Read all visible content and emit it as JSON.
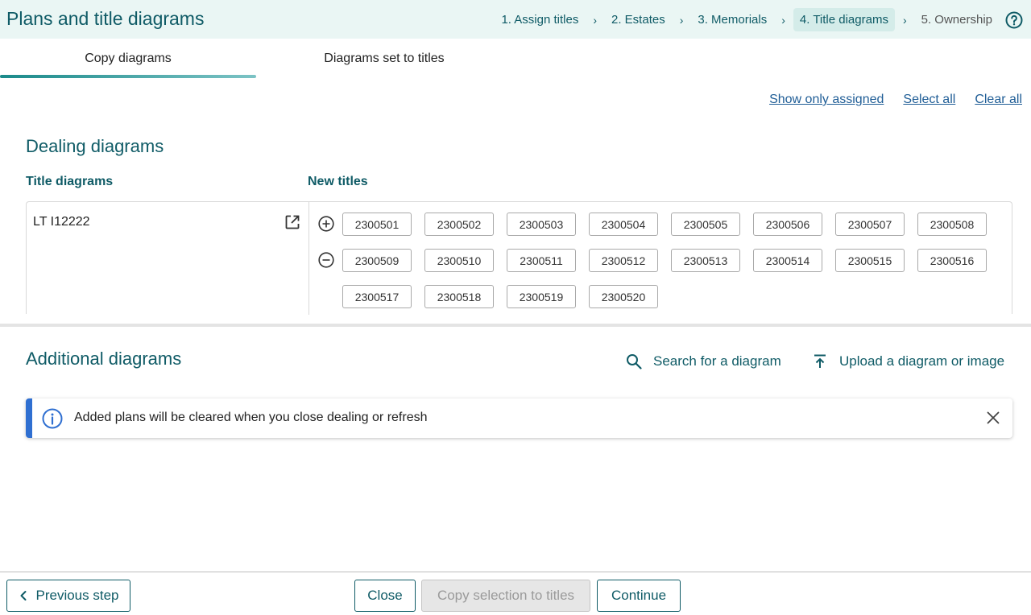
{
  "header": {
    "title": "Plans and title diagrams",
    "steps": [
      {
        "label": "1. Assign titles"
      },
      {
        "label": "2. Estates"
      },
      {
        "label": "3. Memorials"
      },
      {
        "label": "4. Title diagrams"
      },
      {
        "label": "5. Ownership"
      }
    ],
    "step_separator": "›",
    "active_step": 4
  },
  "tabs": [
    {
      "label": "Copy diagrams",
      "active": true
    },
    {
      "label": "Diagrams set to titles",
      "active": false
    }
  ],
  "links": {
    "show_only_assigned": "Show only assigned",
    "select_all": "Select all",
    "clear_all": "Clear all"
  },
  "dealing": {
    "title": "Dealing diagrams",
    "title_diagrams_label": "Title diagrams",
    "new_titles_label": "New titles",
    "title_diagram": "LT I12222",
    "new_titles": [
      "2300501",
      "2300502",
      "2300503",
      "2300504",
      "2300505",
      "2300506",
      "2300507",
      "2300508",
      "2300509",
      "2300510",
      "2300511",
      "2300512",
      "2300513",
      "2300514",
      "2300515",
      "2300516",
      "2300517",
      "2300518",
      "2300519",
      "2300520"
    ]
  },
  "additional": {
    "title": "Additional diagrams",
    "search_label": "Search for a diagram",
    "upload_label": "Upload a diagram or image",
    "info_message": "Added plans will be cleared when you close dealing or refresh"
  },
  "footer": {
    "previous_label": "Previous step",
    "close_label": "Close",
    "copy_label": "Copy selection to titles",
    "continue_label": "Continue"
  },
  "colors": {
    "brand_teal": "#0f5b66",
    "header_bg": "#eaf6f4",
    "link_blue": "#1f5d96",
    "info_accent": "#2f6fd1"
  },
  "icons": [
    "help-icon",
    "open-external-icon",
    "plus-circle-icon",
    "minus-circle-icon",
    "search-icon",
    "upload-icon",
    "info-icon",
    "close-icon",
    "chevron-left-icon"
  ]
}
